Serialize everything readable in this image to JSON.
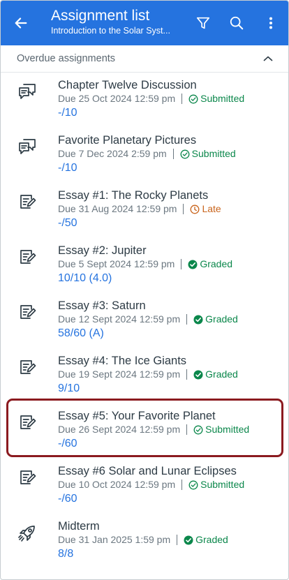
{
  "header": {
    "title": "Assignment list",
    "subtitle": "Introduction to the Solar Syst...",
    "bar_color": "#2573df",
    "icons": [
      "back-arrow-icon",
      "filter-icon",
      "search-icon",
      "more-vertical-icon"
    ]
  },
  "section": {
    "title": "Overdue assignments",
    "expanded": true,
    "icon": "chevron-up-icon"
  },
  "assignments": [
    {
      "icon": "discussion-icon",
      "title": "Chapter Twelve Discussion",
      "due": "Due 25 Oct 2024 12:59 pm",
      "status": "Submitted",
      "status_type": "submitted",
      "score": "-/10"
    },
    {
      "icon": "discussion-icon",
      "title": "Favorite Planetary Pictures",
      "due": "Due 7 Dec 2024 2:59 pm",
      "status": "Submitted",
      "status_type": "submitted",
      "score": "-/10"
    },
    {
      "icon": "assignment-icon",
      "title": "Essay #1: The Rocky Planets",
      "due": "Due 31 Aug 2024 12:59 pm",
      "status": "Late",
      "status_type": "late",
      "score": "-/50"
    },
    {
      "icon": "assignment-icon",
      "title": "Essay #2: Jupiter",
      "due": "Due 5 Sept 2024 12:59 pm",
      "status": "Graded",
      "status_type": "graded",
      "score": "10/10 (4.0)"
    },
    {
      "icon": "assignment-icon",
      "title": "Essay #3: Saturn",
      "due": "Due 12 Sept 2024 12:59 pm",
      "status": "Graded",
      "status_type": "graded",
      "score": "58/60 (A)"
    },
    {
      "icon": "assignment-icon",
      "title": "Essay #4: The Ice Giants",
      "due": "Due 19 Sept 2024 12:59 pm",
      "status": "Graded",
      "status_type": "graded",
      "score": "9/10"
    },
    {
      "icon": "assignment-icon",
      "title": "Essay #5: Your Favorite Planet",
      "due": "Due 26 Sept 2024 12:59 pm",
      "status": "Submitted",
      "status_type": "submitted",
      "score": "-/60",
      "highlighted": true
    },
    {
      "icon": "assignment-icon",
      "title": "Essay #6 Solar and Lunar Eclipses",
      "due": "Due 10 Oct 2024 12:59 pm",
      "status": "Submitted",
      "status_type": "submitted",
      "score": "-/60"
    },
    {
      "icon": "quiz-rocket-icon",
      "title": "Midterm",
      "due": "Due 31 Jan 2025 1:59 pm",
      "status": "Graded",
      "status_type": "graded",
      "score": "8/8"
    }
  ],
  "colors": {
    "accent": "#2573df",
    "submitted": "#0b874b",
    "graded": "#0b874b",
    "late": "#c9641c",
    "highlight_border": "#8b1a1f"
  }
}
